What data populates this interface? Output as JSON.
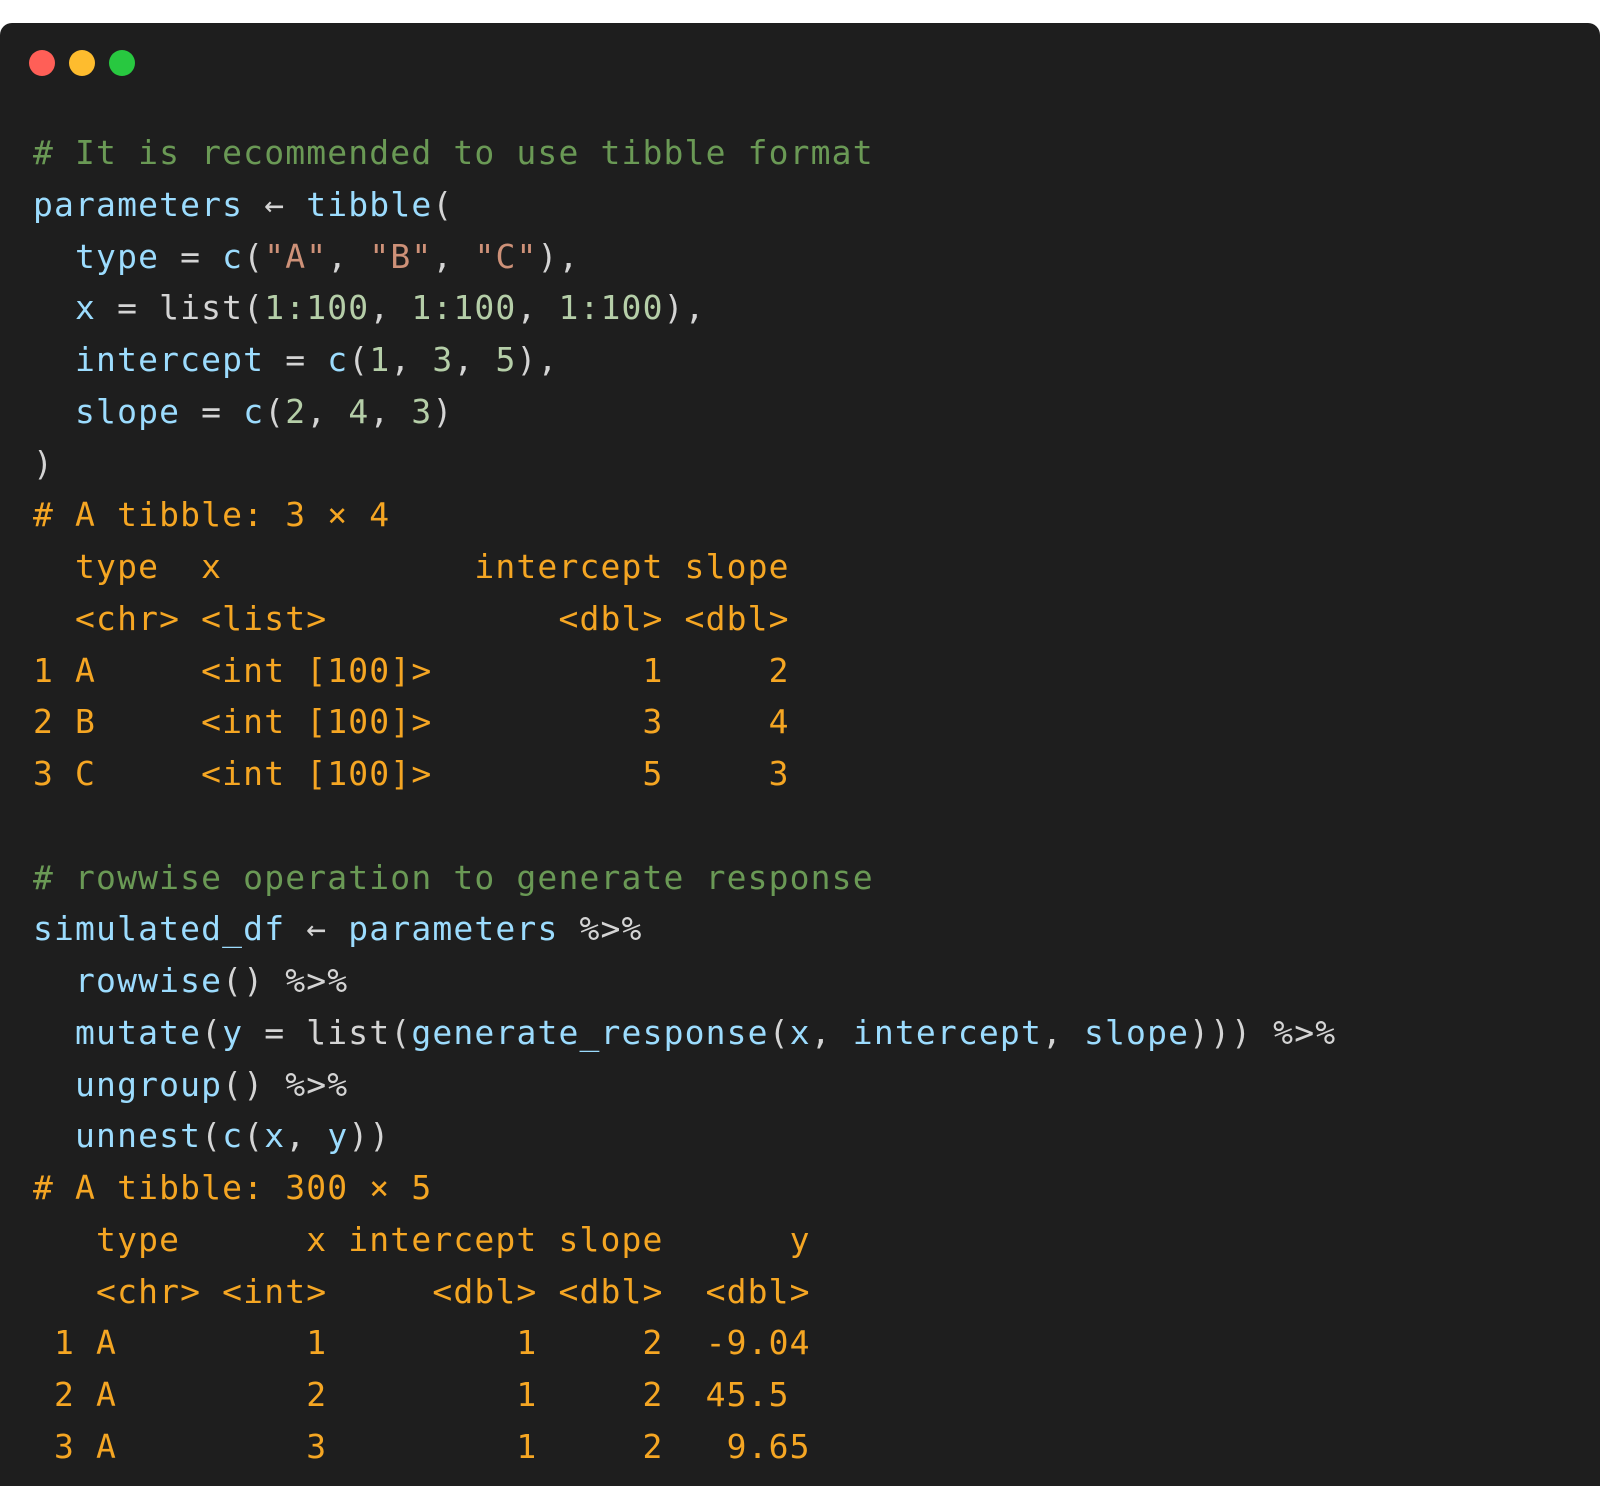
{
  "colors": {
    "background": "#1e1e1e",
    "window_dot_red": "#ff5f57",
    "window_dot_yellow": "#febc2e",
    "window_dot_green": "#28c840",
    "comment": "#6a9955",
    "variable": "#9cdcfe",
    "function": "#dcdcaa",
    "string": "#ce9178",
    "number": "#b5cea8",
    "plain": "#d4d4d4",
    "output": "#f5a623"
  },
  "code_lines": [
    [
      {
        "t": "# It is recommended to use tibble format",
        "c": "comment"
      }
    ],
    [
      {
        "t": "parameters",
        "c": "variable"
      },
      {
        "t": " ← ",
        "c": "plain"
      },
      {
        "t": "tibble",
        "c": "variable"
      },
      {
        "t": "(",
        "c": "plain"
      }
    ],
    [
      {
        "t": "  type",
        "c": "variable"
      },
      {
        "t": " = ",
        "c": "plain"
      },
      {
        "t": "c",
        "c": "variable"
      },
      {
        "t": "(",
        "c": "plain"
      },
      {
        "t": "\"A\"",
        "c": "string"
      },
      {
        "t": ", ",
        "c": "plain"
      },
      {
        "t": "\"B\"",
        "c": "string"
      },
      {
        "t": ", ",
        "c": "plain"
      },
      {
        "t": "\"C\"",
        "c": "string"
      },
      {
        "t": "),",
        "c": "plain"
      }
    ],
    [
      {
        "t": "  x",
        "c": "variable"
      },
      {
        "t": " = list(",
        "c": "plain"
      },
      {
        "t": "1:100",
        "c": "number"
      },
      {
        "t": ", ",
        "c": "plain"
      },
      {
        "t": "1:100",
        "c": "number"
      },
      {
        "t": ", ",
        "c": "plain"
      },
      {
        "t": "1:100",
        "c": "number"
      },
      {
        "t": "),",
        "c": "plain"
      }
    ],
    [
      {
        "t": "  intercept",
        "c": "variable"
      },
      {
        "t": " = ",
        "c": "plain"
      },
      {
        "t": "c",
        "c": "variable"
      },
      {
        "t": "(",
        "c": "plain"
      },
      {
        "t": "1",
        "c": "number"
      },
      {
        "t": ", ",
        "c": "plain"
      },
      {
        "t": "3",
        "c": "number"
      },
      {
        "t": ", ",
        "c": "plain"
      },
      {
        "t": "5",
        "c": "number"
      },
      {
        "t": "),",
        "c": "plain"
      }
    ],
    [
      {
        "t": "  slope",
        "c": "variable"
      },
      {
        "t": " = ",
        "c": "plain"
      },
      {
        "t": "c",
        "c": "variable"
      },
      {
        "t": "(",
        "c": "plain"
      },
      {
        "t": "2",
        "c": "number"
      },
      {
        "t": ", ",
        "c": "plain"
      },
      {
        "t": "4",
        "c": "number"
      },
      {
        "t": ", ",
        "c": "plain"
      },
      {
        "t": "3",
        "c": "number"
      },
      {
        "t": ")",
        "c": "plain"
      }
    ],
    [
      {
        "t": ")",
        "c": "plain"
      }
    ],
    [
      {
        "t": "# A tibble: 3 × 4",
        "c": "output"
      }
    ],
    [
      {
        "t": "  type  x            intercept slope",
        "c": "output"
      }
    ],
    [
      {
        "t": "  <chr> <list>           <dbl> <dbl>",
        "c": "output"
      }
    ],
    [
      {
        "t": "1 A     <int [100]>          1     2",
        "c": "output"
      }
    ],
    [
      {
        "t": "2 B     <int [100]>          3     4",
        "c": "output"
      }
    ],
    [
      {
        "t": "3 C     <int [100]>          5     3",
        "c": "output"
      }
    ],
    [],
    [
      {
        "t": "# rowwise operation to generate response",
        "c": "comment"
      }
    ],
    [
      {
        "t": "simulated_df",
        "c": "variable"
      },
      {
        "t": " ← ",
        "c": "plain"
      },
      {
        "t": "parameters",
        "c": "variable"
      },
      {
        "t": " %>%",
        "c": "plain"
      }
    ],
    [
      {
        "t": "  rowwise",
        "c": "variable"
      },
      {
        "t": "() %>%",
        "c": "plain"
      }
    ],
    [
      {
        "t": "  mutate",
        "c": "variable"
      },
      {
        "t": "(",
        "c": "plain"
      },
      {
        "t": "y",
        "c": "variable"
      },
      {
        "t": " = list(",
        "c": "plain"
      },
      {
        "t": "generate_response",
        "c": "variable"
      },
      {
        "t": "(",
        "c": "plain"
      },
      {
        "t": "x",
        "c": "variable"
      },
      {
        "t": ", ",
        "c": "plain"
      },
      {
        "t": "intercept",
        "c": "variable"
      },
      {
        "t": ", ",
        "c": "plain"
      },
      {
        "t": "slope",
        "c": "variable"
      },
      {
        "t": "))) %>%",
        "c": "plain"
      }
    ],
    [
      {
        "t": "  ungroup",
        "c": "variable"
      },
      {
        "t": "() %>%",
        "c": "plain"
      }
    ],
    [
      {
        "t": "  unnest",
        "c": "variable"
      },
      {
        "t": "(",
        "c": "plain"
      },
      {
        "t": "c",
        "c": "variable"
      },
      {
        "t": "(",
        "c": "plain"
      },
      {
        "t": "x",
        "c": "variable"
      },
      {
        "t": ", ",
        "c": "plain"
      },
      {
        "t": "y",
        "c": "variable"
      },
      {
        "t": "))",
        "c": "plain"
      }
    ],
    [
      {
        "t": "# A tibble: 300 × 5",
        "c": "output"
      }
    ],
    [
      {
        "t": "   type      x intercept slope      y",
        "c": "output"
      }
    ],
    [
      {
        "t": "   <chr> <int>     <dbl> <dbl>  <dbl>",
        "c": "output"
      }
    ],
    [
      {
        "t": " 1 A         1         1     2  -9.04",
        "c": "output"
      }
    ],
    [
      {
        "t": " 2 A         2         1     2  45.5",
        "c": "output"
      }
    ],
    [
      {
        "t": " 3 A         3         1     2   9.65",
        "c": "output"
      }
    ]
  ]
}
